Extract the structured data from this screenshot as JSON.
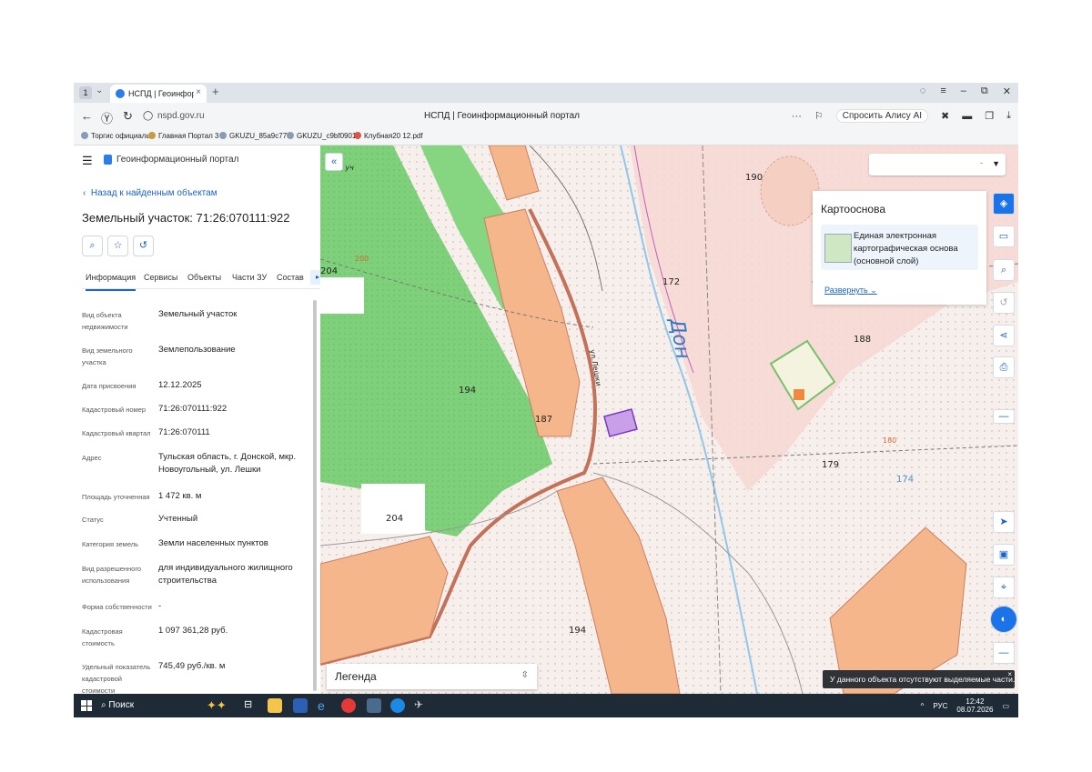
{
  "browser": {
    "tab_counter": "1",
    "tab_title": "НСПД | Геоинформацио",
    "url": "nspd.gov.ru",
    "page_title": "НСПД | Геоинформационный портал",
    "alice_label": "Спросить Алису AI",
    "bookmarks": [
      "Торгис официаль",
      "Главная Портал 3",
      "GKUZU_85a9c777",
      "GKUZU_c9bf0901",
      "Клубная20 12.pdf"
    ]
  },
  "panel": {
    "portal_name": "Геоинформационный портал",
    "back_link": "Назад к найденным объектам",
    "title": "Земельный участок: 71:26:070111:922",
    "tabs": [
      "Информация",
      "Сервисы",
      "Объекты",
      "Части ЗУ",
      "Состав"
    ],
    "rows": [
      {
        "label": "Вид объекта недвижимости",
        "value": "Земельный участок"
      },
      {
        "label": "Вид земельного участка",
        "value": "Землепользование"
      },
      {
        "label": "Дата присвоения",
        "value": "12.12.2025"
      },
      {
        "label": "Кадастровый номер",
        "value": "71:26:070111:922"
      },
      {
        "label": "Кадастровый квартал",
        "value": "71:26:070111"
      },
      {
        "label": "Адрес",
        "value": "Тульская область, г. Донской, мкр. Новоугольный, ул. Лешки"
      },
      {
        "label": "Площадь уточненная",
        "value": "1 472 кв. м"
      },
      {
        "label": "Статус",
        "value": "Учтенный"
      },
      {
        "label": "Категория земель",
        "value": "Земли населенных пунктов"
      },
      {
        "label": "Вид разрешенного использования",
        "value": "для индивидуального жилищного строительства"
      },
      {
        "label": "Форма собственности",
        "value": "-"
      },
      {
        "label": "Кадастровая стоимость",
        "value": "1 097 361,28 руб."
      },
      {
        "label": "Удельный показатель кадастровой стоимости",
        "value": "745,49 руб./кв. м"
      }
    ]
  },
  "map": {
    "search_value": "-",
    "kartoosnova": {
      "title": "Картооснова",
      "item": "Единая электронная картографическая основа (основной слой)",
      "expand": "Развернуть"
    },
    "legend_label": "Легенда",
    "toast": "У данного объекта отсутствуют выделяемые части.",
    "labels": {
      "l190": "190",
      "l172": "172",
      "l188": "188",
      "l179": "179",
      "l174": "174",
      "l180": "180",
      "l194a": "194",
      "l194b": "194",
      "l187": "187",
      "l204a": "204",
      "l204b": "204",
      "l200": "200",
      "river": "Дон",
      "street": "ул.Лешки",
      "sad": "сад уч"
    }
  },
  "taskbar": {
    "search": "Поиск",
    "lang": "РУС",
    "time": "12:42",
    "date": "08.07.2026"
  }
}
